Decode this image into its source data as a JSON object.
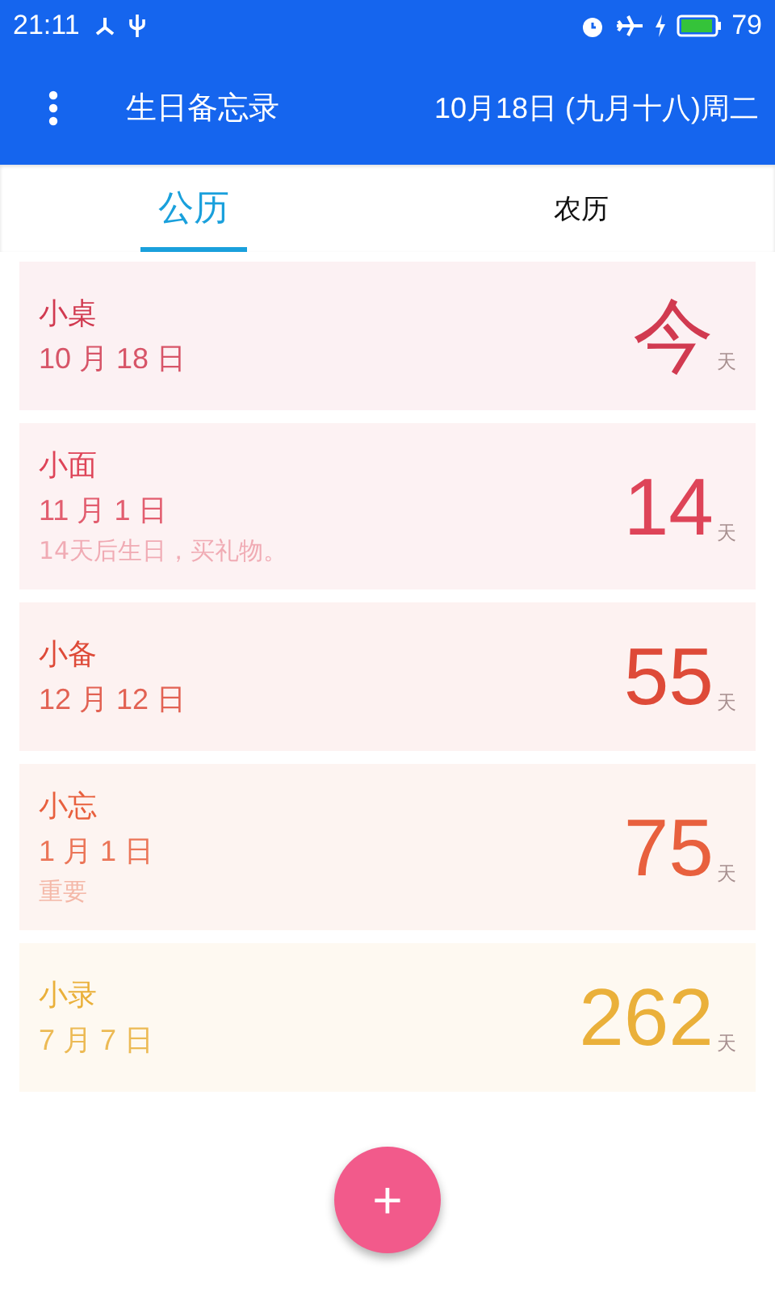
{
  "status_bar": {
    "time": "21:11",
    "battery": "79"
  },
  "app_bar": {
    "title": "生日备忘录",
    "date": "10月18日 (九月十八)周二"
  },
  "tabs": [
    {
      "label": "公历",
      "selected": true
    },
    {
      "label": "农历",
      "selected": false
    }
  ],
  "birthdays": [
    {
      "name": "小桌",
      "date": "10 月 18 日",
      "days": "今",
      "unit": "天",
      "color": "#d13a50"
    },
    {
      "name": "小面",
      "date": "11 月 1 日",
      "note": "14天后生日，买礼物。",
      "days": "14",
      "unit": "天",
      "color": "#de4458"
    },
    {
      "name": "小备",
      "date": "12 月 12 日",
      "days": "55",
      "unit": "天",
      "color": "#de4a38"
    },
    {
      "name": "小忘",
      "date": "1 月 1 日",
      "note": "重要",
      "days": "75",
      "unit": "天",
      "color": "#e8603e"
    },
    {
      "name": "小录",
      "date": "7 月 7 日",
      "days": "262",
      "unit": "天",
      "color": "#eab03a"
    }
  ],
  "fab": {
    "label": "+"
  }
}
